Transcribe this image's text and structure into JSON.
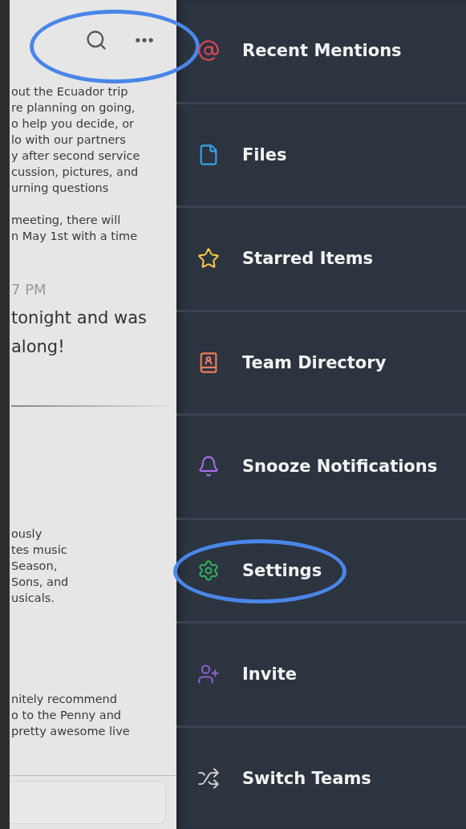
{
  "chat": {
    "header": {
      "circled": true
    },
    "blocks": [
      {
        "kind": "small",
        "lines": [
          "out the Ecuador trip",
          "re planning on going,",
          "o help you decide, or",
          "lo with our partners",
          "y after second service",
          "cussion, pictures, and",
          "urning questions"
        ]
      },
      {
        "kind": "small",
        "lines": [
          "meeting, there will",
          "n May 1st with a time"
        ]
      },
      {
        "kind": "time",
        "lines": [
          "7 PM"
        ]
      },
      {
        "kind": "large",
        "lines": [
          "tonight and was",
          "along!"
        ]
      },
      {
        "kind": "rule"
      },
      {
        "kind": "small",
        "lines": [
          "ously",
          "tes music",
          "Season,",
          "Sons, and",
          "usicals."
        ]
      },
      {
        "kind": "small",
        "lines": [
          "nitely recommend",
          "o to the Penny and",
          "pretty awesome live"
        ]
      }
    ]
  },
  "menu": [
    {
      "kind": "mention",
      "label": "Recent Mentions",
      "circled": false
    },
    {
      "kind": "file",
      "label": "Files",
      "circled": false
    },
    {
      "kind": "star",
      "label": "Starred Items",
      "circled": false
    },
    {
      "kind": "directory",
      "label": "Team Directory",
      "circled": false
    },
    {
      "kind": "bell",
      "label": "Snooze Notifications",
      "circled": false
    },
    {
      "kind": "gear",
      "label": "Settings",
      "circled": true
    },
    {
      "kind": "invite",
      "label": "Invite",
      "circled": false
    },
    {
      "kind": "switch",
      "label": "Switch Teams",
      "circled": false
    }
  ]
}
